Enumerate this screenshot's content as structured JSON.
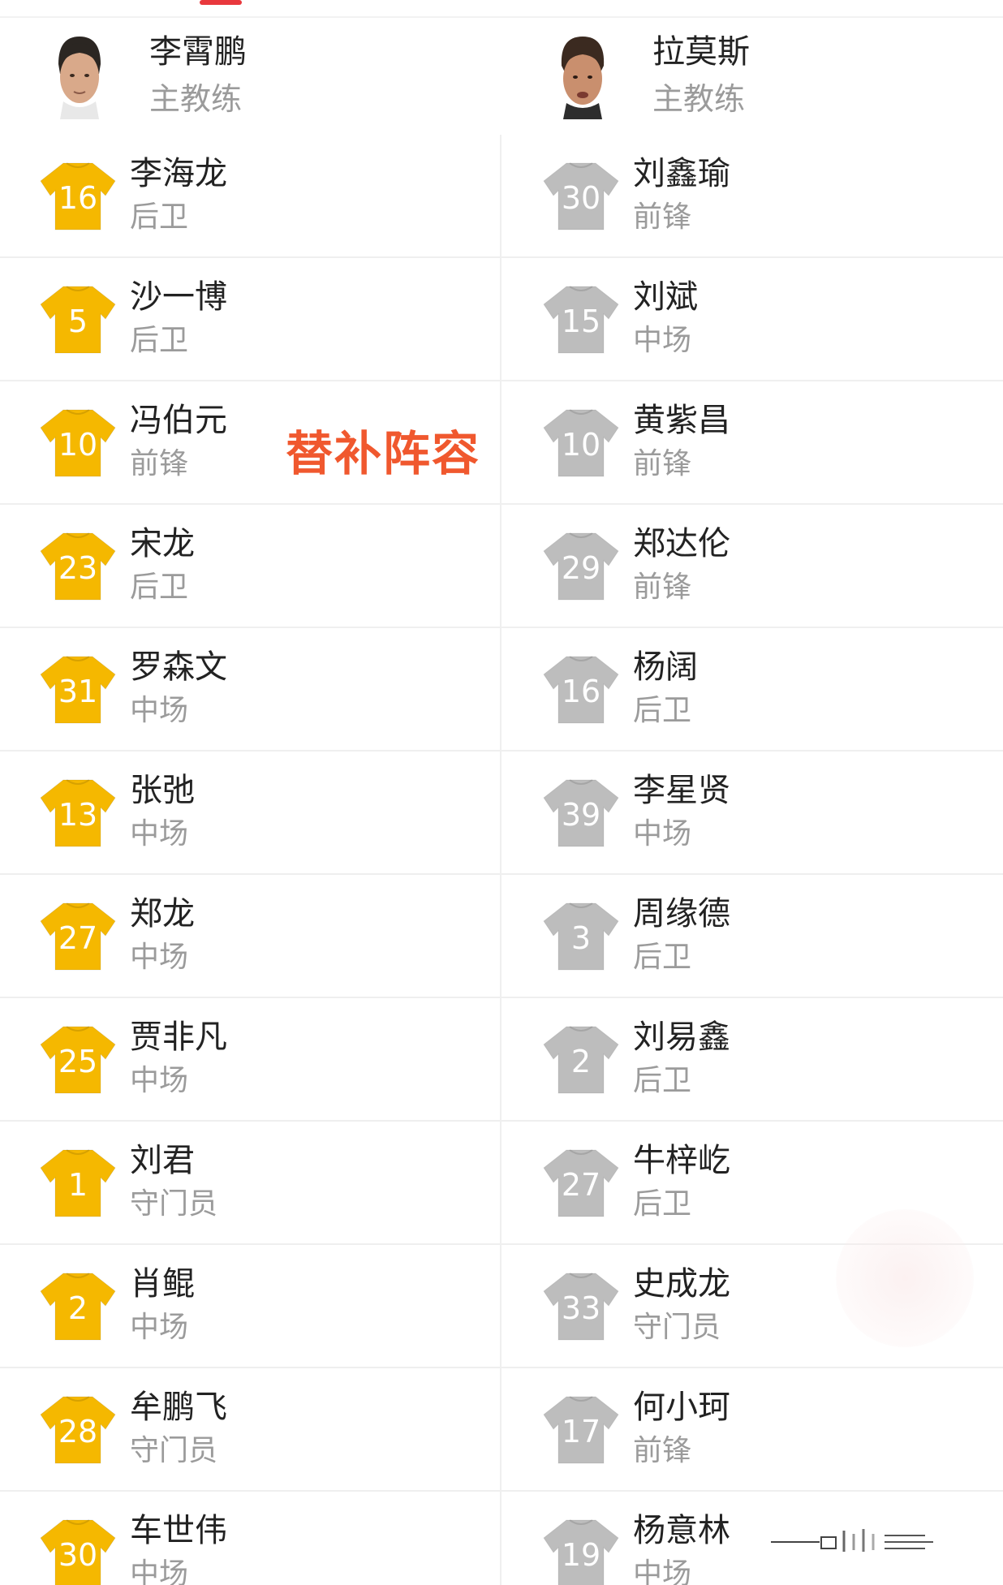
{
  "colors": {
    "home_jersey": "#f5b800",
    "away_jersey": "#bdbdbd",
    "overlay_label": "#f0582e",
    "accent": "#e8383d"
  },
  "overlay_label": "替补阵容",
  "coaches": {
    "home": {
      "name": "李霄鹏",
      "role": "主教练"
    },
    "away": {
      "name": "拉莫斯",
      "role": "主教练"
    }
  },
  "rows": [
    {
      "home": {
        "number": "16",
        "name": "李海龙",
        "position": "后卫"
      },
      "away": {
        "number": "30",
        "name": "刘鑫瑜",
        "position": "前锋"
      }
    },
    {
      "home": {
        "number": "5",
        "name": "沙一博",
        "position": "后卫"
      },
      "away": {
        "number": "15",
        "name": "刘斌",
        "position": "中场"
      }
    },
    {
      "home": {
        "number": "10",
        "name": "冯伯元",
        "position": "前锋"
      },
      "away": {
        "number": "10",
        "name": "黄紫昌",
        "position": "前锋"
      }
    },
    {
      "home": {
        "number": "23",
        "name": "宋龙",
        "position": "后卫"
      },
      "away": {
        "number": "29",
        "name": "郑达伦",
        "position": "前锋"
      }
    },
    {
      "home": {
        "number": "31",
        "name": "罗森文",
        "position": "中场"
      },
      "away": {
        "number": "16",
        "name": "杨阔",
        "position": "后卫"
      }
    },
    {
      "home": {
        "number": "13",
        "name": "张弛",
        "position": "中场"
      },
      "away": {
        "number": "39",
        "name": "李星贤",
        "position": "中场"
      }
    },
    {
      "home": {
        "number": "27",
        "name": "郑龙",
        "position": "中场"
      },
      "away": {
        "number": "3",
        "name": "周缘德",
        "position": "后卫"
      }
    },
    {
      "home": {
        "number": "25",
        "name": "贾非凡",
        "position": "中场"
      },
      "away": {
        "number": "2",
        "name": "刘易鑫",
        "position": "后卫"
      }
    },
    {
      "home": {
        "number": "1",
        "name": "刘君",
        "position": "守门员"
      },
      "away": {
        "number": "27",
        "name": "牛梓屹",
        "position": "后卫"
      }
    },
    {
      "home": {
        "number": "2",
        "name": "肖鲲",
        "position": "中场"
      },
      "away": {
        "number": "33",
        "name": "史成龙",
        "position": "守门员"
      }
    },
    {
      "home": {
        "number": "28",
        "name": "牟鹏飞",
        "position": "守门员"
      },
      "away": {
        "number": "17",
        "name": "何小珂",
        "position": "前锋"
      }
    },
    {
      "home": {
        "number": "30",
        "name": "车世伟",
        "position": "中场"
      },
      "away": {
        "number": "19",
        "name": "杨意林",
        "position": "中场"
      }
    }
  ]
}
